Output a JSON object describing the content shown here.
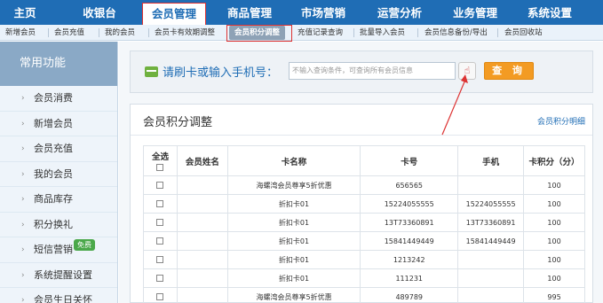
{
  "topnav": {
    "items": [
      "主页",
      "收银台",
      "会员管理",
      "商品管理",
      "市场营销",
      "运营分析",
      "业务管理",
      "系统设置"
    ]
  },
  "subnav": {
    "items": [
      "新增会员",
      "会员充值",
      "我的会员",
      "会员卡有效期调整",
      "会员积分调整",
      "充值记录查询",
      "批量导入会员",
      "会员信息备份/导出",
      "会员回收站"
    ]
  },
  "sidebar": {
    "header": "常用功能",
    "items": [
      "会员消费",
      "新增会员",
      "会员充值",
      "我的会员",
      "商品库存",
      "积分换礼",
      "短信营销",
      "系统提醒设置",
      "会员生日关怀"
    ],
    "badge": "免费"
  },
  "search": {
    "label": "请刷卡或输入手机号：",
    "placeholder": "不输入查询条件，可查询所有会员信息",
    "button": "查 询"
  },
  "panel": {
    "title": "会员积分调整",
    "link": "会员积分明细"
  },
  "table": {
    "headers": [
      "全选",
      "会员姓名",
      "卡名称",
      "卡号",
      "手机",
      "卡积分（分）"
    ],
    "rows": [
      {
        "name": "",
        "card": "海螺湾会员尊享5折优惠",
        "no": "656565",
        "phone": "",
        "points": "100"
      },
      {
        "name": "",
        "card": "折扣卡01",
        "no": "15224055555",
        "phone": "15224055555",
        "points": "100"
      },
      {
        "name": "",
        "card": "折扣卡01",
        "no": "13T73360891",
        "phone": "13T73360891",
        "points": "100"
      },
      {
        "name": "",
        "card": "折扣卡01",
        "no": "15841449449",
        "phone": "15841449449",
        "points": "100"
      },
      {
        "name": "",
        "card": "折扣卡01",
        "no": "1213242",
        "phone": "",
        "points": "100"
      },
      {
        "name": "",
        "card": "折扣卡01",
        "no": "111231",
        "phone": "",
        "points": "100"
      },
      {
        "name": "",
        "card": "海螺湾会员尊享5折优惠",
        "no": "489789",
        "phone": "",
        "points": "995"
      }
    ]
  },
  "colors": {
    "nav_blue": "#1f6db5",
    "highlight_red": "#dd3333",
    "button_orange": "#f39b23"
  }
}
